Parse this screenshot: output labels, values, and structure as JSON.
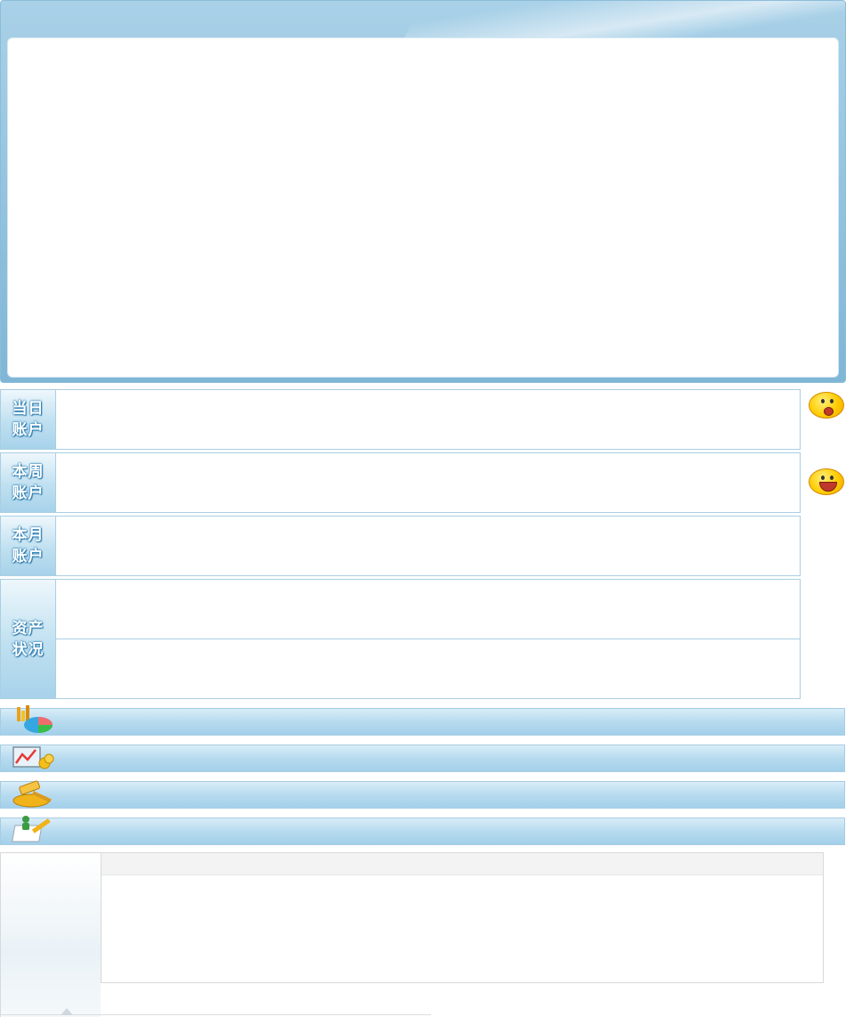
{
  "accounts": [
    {
      "label": "当日\n账户"
    },
    {
      "label": "本周\n账户"
    },
    {
      "label": "本月\n账户"
    },
    {
      "label": "资产\n状况"
    }
  ],
  "icons": {
    "smiley_sad": "sad-smiley-icon",
    "smiley_happy": "happy-smiley-icon",
    "bar1": "chart-pie-icon",
    "bar2": "stock-trend-icon",
    "bar3": "auction-hammer-icon",
    "bar4": "user-edit-icon"
  },
  "colors": {
    "accent": "#7fb6d6",
    "label_text_outline": "#2a7fb6",
    "border": "#a9cfe3"
  }
}
